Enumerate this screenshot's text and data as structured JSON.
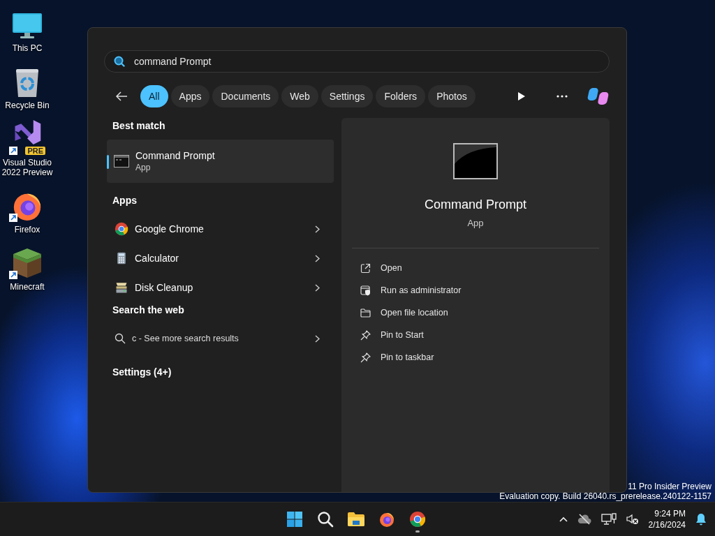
{
  "desktop_icons": [
    {
      "label": "This PC",
      "kind": "monitor",
      "shortcut": false
    },
    {
      "label": "Recycle Bin",
      "kind": "bin",
      "shortcut": false
    },
    {
      "label": "Visual Studio 2022 Preview",
      "kind": "vs",
      "badge": "PRE",
      "shortcut": true
    },
    {
      "label": "Firefox",
      "kind": "firefox",
      "shortcut": true
    },
    {
      "label": "Minecraft",
      "kind": "grass",
      "shortcut": true
    }
  ],
  "search": {
    "value": "command Prompt"
  },
  "filters": [
    {
      "label": "All",
      "selected": true
    },
    {
      "label": "Apps",
      "selected": false
    },
    {
      "label": "Documents",
      "selected": false
    },
    {
      "label": "Web",
      "selected": false
    },
    {
      "label": "Settings",
      "selected": false
    },
    {
      "label": "Folders",
      "selected": false
    },
    {
      "label": "Photos",
      "selected": false
    }
  ],
  "best_match": {
    "heading": "Best match",
    "title": "Command Prompt",
    "subtitle": "App",
    "selected": true
  },
  "apps": {
    "heading": "Apps",
    "items": [
      {
        "label": "Google Chrome",
        "kind": "chrome"
      },
      {
        "label": "Calculator",
        "kind": "calculator"
      },
      {
        "label": "Disk Cleanup",
        "kind": "disk"
      }
    ]
  },
  "web": {
    "heading": "Search the web",
    "text": "c - See more search results"
  },
  "settings_heading": "Settings (4+)",
  "details": {
    "title": "Command Prompt",
    "subtitle": "App",
    "actions": [
      {
        "label": "Open",
        "kind": "open"
      },
      {
        "label": "Run as administrator",
        "kind": "admin"
      },
      {
        "label": "Open file location",
        "kind": "folder"
      },
      {
        "label": "Pin to Start",
        "kind": "pin"
      },
      {
        "label": "Pin to taskbar",
        "kind": "pin"
      }
    ]
  },
  "watermark": {
    "line_1": "11 Pro Insider Preview",
    "line_2": "Evaluation copy. Build 26040.rs_prerelease.240122-1157"
  },
  "taskbar": {
    "apps": [
      {
        "kind": "start",
        "running": false
      },
      {
        "kind": "search",
        "running": false
      },
      {
        "kind": "folder",
        "running": false
      },
      {
        "kind": "firefox",
        "running": false
      },
      {
        "kind": "chrome",
        "running": true
      }
    ],
    "time": "9:24 PM",
    "date": "2/16/2024"
  }
}
